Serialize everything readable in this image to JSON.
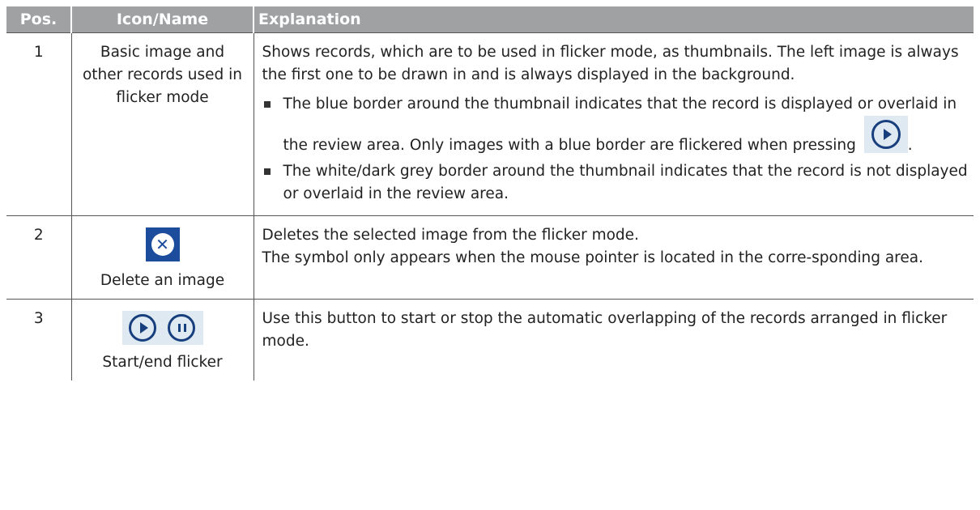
{
  "table": {
    "headers": [
      "Pos.",
      "Icon/Name",
      "Explanation"
    ],
    "rows": [
      {
        "pos": "1",
        "name": "Basic image and other records used in flicker mode",
        "explanation": "Shows records, which are to be used in flicker mode, as thumbnails. The left image is always the first one to be drawn in and is always displayed in the background.",
        "bullets": [
          {
            "text_before_icon": "The blue border around the thumbnail indicates that the record is displayed or overlaid in the review area. Only images with a blue border are flickered when pressing",
            "icon": "play-icon",
            "text_after_icon": "."
          },
          {
            "text": "The white/dark grey border around the thumbnail indicates that the record is not displayed or overlaid in the review area."
          }
        ]
      },
      {
        "pos": "2",
        "icon": "delete-icon",
        "name": "Delete an image",
        "explanation_lines": [
          "Deletes the selected image from the flicker mode.",
          "The symbol only appears when the mouse pointer is located in the corre-sponding area."
        ]
      },
      {
        "pos": "3",
        "icons": [
          "play-icon",
          "pause-icon"
        ],
        "name": "Start/end flicker",
        "explanation": "Use this button to start or stop the automatic overlapping of the records arranged in flicker mode."
      }
    ]
  },
  "colors": {
    "header_bg": "#9fa1a3",
    "icon_dark_blue": "#173f7d",
    "icon_bg_light": "#dfe9f2",
    "delete_bg": "#1c4c9c"
  }
}
